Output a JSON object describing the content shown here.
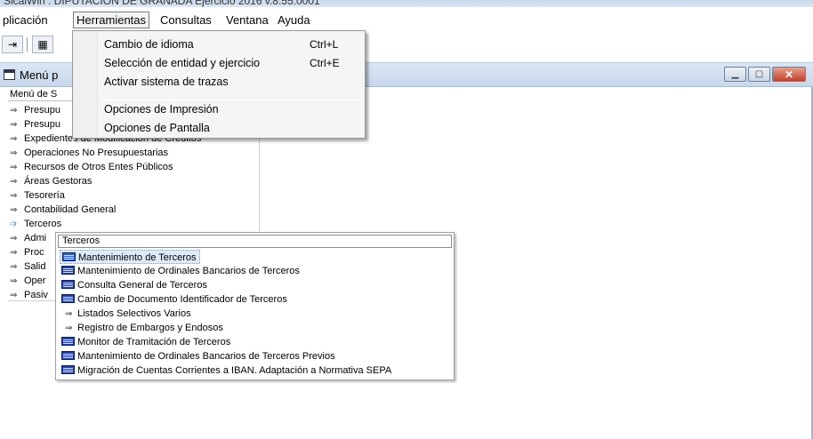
{
  "window": {
    "title": "SicalWin : DIPUTACION DE GRANADA Ejercicio 2016 v.8.55.0001"
  },
  "menubar": {
    "items": [
      {
        "label": "plicación"
      },
      {
        "label": "Herramientas"
      },
      {
        "label": "Consultas"
      },
      {
        "label": "Ventana"
      },
      {
        "label": "Ayuda"
      }
    ]
  },
  "herramientas_menu": {
    "items": [
      {
        "label": "Cambio de idioma",
        "shortcut": "Ctrl+L"
      },
      {
        "label": "Selección de entidad y ejercicio",
        "shortcut": "Ctrl+E"
      },
      {
        "label": "Activar sistema de trazas",
        "shortcut": ""
      },
      {
        "label": "Opciones de Impresión",
        "shortcut": ""
      },
      {
        "label": "Opciones de Pantalla",
        "shortcut": ""
      }
    ]
  },
  "mdi_window": {
    "title": "Menú p"
  },
  "tree": {
    "header": "Menú de S",
    "items": [
      {
        "label": "Presupu"
      },
      {
        "label": "Presupu"
      },
      {
        "label": "Expedientes de Modificación de Créditos"
      },
      {
        "label": "Operaciones No Presupuestarias"
      },
      {
        "label": "Recursos de Otros Entes Públicos"
      },
      {
        "label": "Áreas Gestoras"
      },
      {
        "label": "Tesorería"
      },
      {
        "label": "Contabilidad General"
      },
      {
        "label": "Terceros"
      },
      {
        "label": "Admi"
      },
      {
        "label": "Proc"
      },
      {
        "label": "Salid"
      },
      {
        "label": "Oper"
      },
      {
        "label": "Pasiv"
      }
    ]
  },
  "terceros_submenu": {
    "header": "Terceros",
    "items": [
      {
        "label": "Mantenimiento de Terceros",
        "icon": "grid-icon"
      },
      {
        "label": "Mantenimiento de Ordinales Bancarios de Terceros",
        "icon": "form-icon"
      },
      {
        "label": "Consulta General de Terceros",
        "icon": "form-icon"
      },
      {
        "label": "Cambio de Documento Identificador de Terceros",
        "icon": "form-icon"
      },
      {
        "label": "Listados Selectivos Varios",
        "icon": "arrow-icon"
      },
      {
        "label": "Registro de Embargos y Endosos",
        "icon": "arrow-icon"
      },
      {
        "label": "Monitor de Tramitación de Terceros",
        "icon": "form-icon"
      },
      {
        "label": "Mantenimiento de Ordinales Bancarios de Terceros Previos",
        "icon": "form-icon"
      },
      {
        "label": "Migración de Cuentas Corrientes a IBAN. Adaptación a Normativa SEPA",
        "icon": "form-icon"
      }
    ]
  },
  "colors": {
    "highlight": "#dfeaf6",
    "caption": "#c8d8ec",
    "close": "#c5402a"
  }
}
